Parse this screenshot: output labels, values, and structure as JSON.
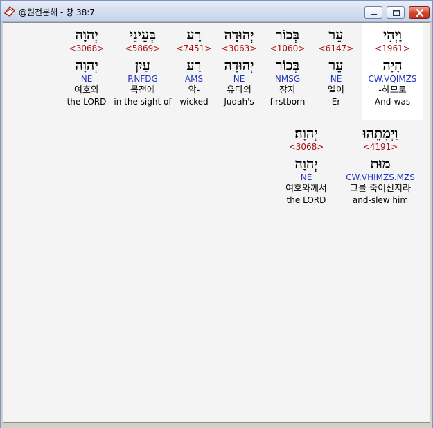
{
  "window": {
    "title": "@원전분해 - 창 38:7",
    "icon": "bible-app-icon"
  },
  "colors": {
    "strong": "#aa1111",
    "parse": "#2233bb",
    "highlight": "#ffffff"
  },
  "rows": [
    {
      "words": [
        {
          "hebrew": "וַיְהִי",
          "strong": "<1961>",
          "lemma": "הָיָה",
          "parse": "CW.VQIMZS",
          "korean": "-하므로",
          "english": "And-was",
          "highlight": true
        },
        {
          "hebrew": "עֵר",
          "strong": "<6147>",
          "lemma": "עֵר",
          "parse": "NE",
          "korean": "엘이",
          "english": "Er"
        },
        {
          "hebrew": "בְּכוֹר",
          "strong": "<1060>",
          "lemma": "בְּכוֹר",
          "parse": "NMSG",
          "korean": "장자",
          "english": "firstborn"
        },
        {
          "hebrew": "יְהוּדָה",
          "strong": "<3063>",
          "lemma": "יְהוּדָה",
          "parse": "NE",
          "korean": "유다의",
          "english": "Judah's"
        },
        {
          "hebrew": "רַע",
          "strong": "<7451>",
          "lemma": "רַע",
          "parse": "AMS",
          "korean": "악-",
          "english": "wicked"
        },
        {
          "hebrew": "בְּעֵינֵי",
          "strong": "<5869>",
          "lemma": "עַיִן",
          "parse": "P.NFDG",
          "korean": "목전에",
          "english": "in the sight of"
        },
        {
          "hebrew": "יְהוָה",
          "strong": "<3068>",
          "lemma": "יְהוָה",
          "parse": "NE",
          "korean": "여호와",
          "english": "the LORD"
        }
      ]
    },
    {
      "words": [
        {
          "hebrew": "וַיְמִתֵהוּ",
          "strong": "<4191>",
          "lemma": "מוּת",
          "parse": "CW.VHIMZS.MZS",
          "korean": "그를 죽이신지라",
          "english": "and-slew him"
        },
        {
          "hebrew": "יְהוָה׃",
          "strong": "<3068>",
          "lemma": "יְהוָה",
          "parse": "NE",
          "korean": "여호와께서",
          "english": "the LORD"
        }
      ]
    }
  ]
}
